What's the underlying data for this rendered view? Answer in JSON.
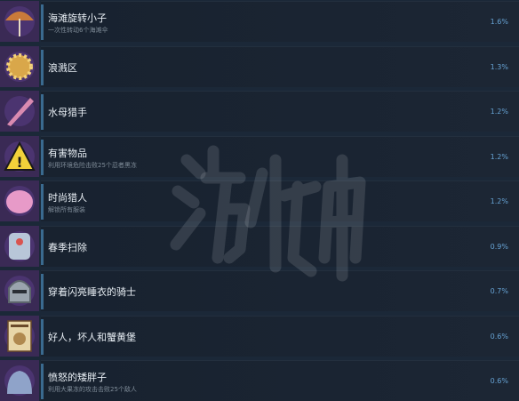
{
  "achievements": [
    {
      "name": "海滩旋转小子",
      "desc": "一次性转动6个海滩伞",
      "percent": "1.6%",
      "icon": "beach-umbrella-icon",
      "color": "#c97a3a"
    },
    {
      "name": "浪溅区",
      "desc": "",
      "percent": "1.3%",
      "icon": "sun-splash-icon",
      "color": "#d9a74a"
    },
    {
      "name": "水母猎手",
      "desc": "",
      "percent": "1.2%",
      "icon": "jellyfish-hunter-icon",
      "color": "#d98ab0"
    },
    {
      "name": "有害物品",
      "desc": "利用环境危险击败25个忍者黑冻",
      "percent": "1.2%",
      "icon": "hazard-sign-icon",
      "color": "#f2d13a"
    },
    {
      "name": "时尚猎人",
      "desc": "解锁所有服装",
      "percent": "1.2%",
      "icon": "fashion-costume-icon",
      "color": "#e79ac8"
    },
    {
      "name": "春季扫除",
      "desc": "",
      "percent": "0.9%",
      "icon": "cleaning-robot-icon",
      "color": "#b8c6d8"
    },
    {
      "name": "穿着闪亮睡衣的骑士",
      "desc": "",
      "percent": "0.7%",
      "icon": "knight-helmet-icon",
      "color": "#9aa4ad"
    },
    {
      "name": "好人，坏人和蟹黄堡",
      "desc": "",
      "percent": "0.6%",
      "icon": "wanted-poster-icon",
      "color": "#e8d6a8"
    },
    {
      "name": "愤怒的矮胖子",
      "desc": "利用大果冻的攻击击败25个敌人",
      "percent": "0.6%",
      "icon": "angry-blob-icon",
      "color": "#8fa3c9"
    }
  ],
  "watermark": {
    "text": "游侠网"
  }
}
